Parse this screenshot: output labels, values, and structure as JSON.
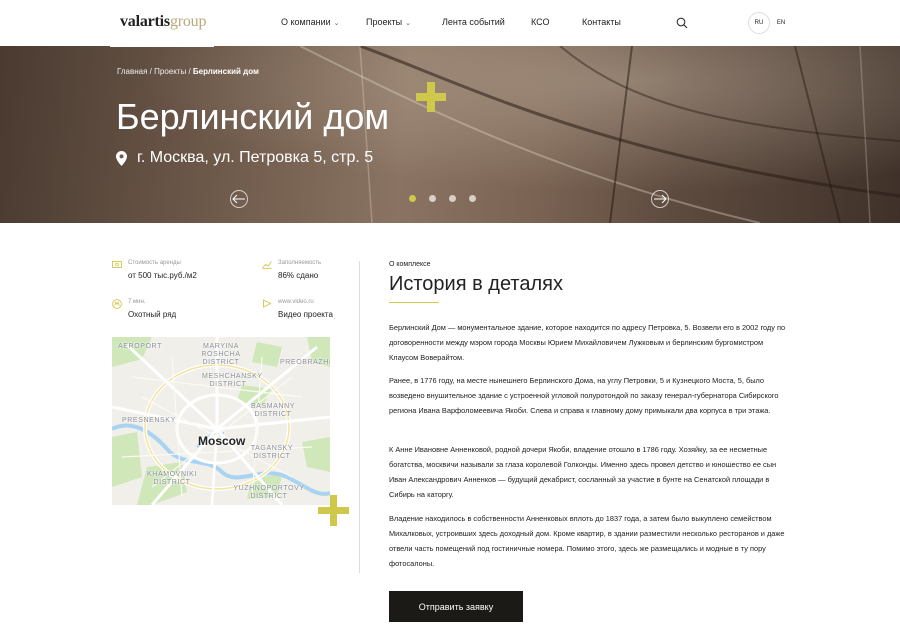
{
  "header": {
    "logo_main": "valartis",
    "logo_accent": "group",
    "nav": [
      {
        "label": "О компании",
        "has_dropdown": true
      },
      {
        "label": "Проекты",
        "has_dropdown": true
      },
      {
        "label": "Лента событий",
        "has_dropdown": false
      },
      {
        "label": "КСО",
        "has_dropdown": false
      },
      {
        "label": "Контакты",
        "has_dropdown": false
      }
    ],
    "search_icon": "search-icon",
    "languages": [
      {
        "code": "RU",
        "active": true
      },
      {
        "code": "EN",
        "active": false
      }
    ]
  },
  "hero": {
    "breadcrumb": {
      "items": [
        "Главная",
        "Проекты"
      ],
      "separator": " / ",
      "current": "Берлинский дом"
    },
    "title": "Берлинский дом",
    "address": "г. Москва, ул. Петровка 5, стр. 5",
    "slider": {
      "count": 4,
      "active": 0
    }
  },
  "stats": [
    {
      "icon": "money-icon",
      "label": "Стоимость аренды",
      "value": "от 500 тыс.руб./м2"
    },
    {
      "icon": "chart-icon",
      "label": "Заполняемость",
      "value": "86% сдано"
    },
    {
      "icon": "metro-icon",
      "label": "7 мин.",
      "value": "Охотный ряд"
    },
    {
      "icon": "play-icon",
      "label": "www.video.ru",
      "value": "Видео проекта"
    }
  ],
  "map": {
    "city": "Moscow",
    "districts": [
      "AEROPORT",
      "MARYINA ROSHCHA DISTRICT",
      "MESHCHANSKY DISTRICT",
      "PREOBRAZHEN",
      "BASMANNY DISTRICT",
      "PRESNENSKY",
      "TAGANSKY DISTRICT",
      "KHAMOVNIKI DISTRICT",
      "YUZHNOPORTOVY DISTRICT"
    ]
  },
  "about": {
    "kicker": "О комплексе",
    "title": "История в деталях",
    "paragraphs": [
      "Берлинский Дом — монументальное здание, которое находится по адресу Петровка, 5. Возвели его в 2002 году по договоренности между мэром города Москвы Юрием Михайловичем Лужковым и берлинским бургомистром Клаусом Воверайтом.",
      "Ранее, в 1776 году, на месте нынешнего Берлинского Дома, на углу Петровки, 5 и Кузнецкого Моста, 5, было возведено внушительное здание с устроенной угловой полуротондой по заказу генерал-губернатора Сибирского региона Ивана Варфоломеевича Якоби. Слева и справа к главному дому примыкали два корпуса в три этажа.",
      "К Анне Ивановне Анненковой, родной дочери Якоби, владение отошло в 1786 году. Хозяйку, за ее несметные богатства, москвичи называли за глаза королевой Голконды. Именно здесь провел детство и юношество ее сын Иван Александрович Анненков — будущий декабрист, сосланный за участие в бунте на Сенатской площади в Сибирь на каторгу.",
      "Владение находилось в собственности Анненковых вплоть до 1837 года, а затем было выкуплено семейством Михалковых, устроивших здесь доходный дом. Кроме квартир, в здании разместили несколько ресторанов и даже отвели часть помещений под гостиничные номера. Помимо этого, здесь же размещались и модные в ту пору фотосалоны."
    ],
    "cta_label": "Отправить заявку"
  },
  "colors": {
    "accent": "#cfc84a",
    "dark": "#1c1a17",
    "logo_accent": "#b8a87a"
  }
}
